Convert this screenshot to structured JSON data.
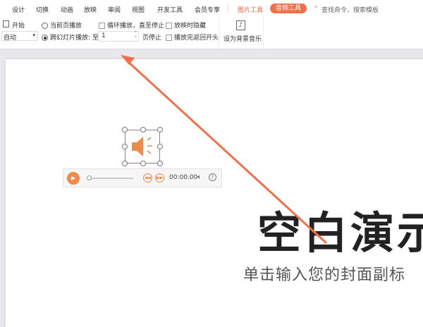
{
  "menu": {
    "tabs": [
      "设计",
      "切换",
      "动画",
      "放映",
      "审阅",
      "视图",
      "开发工具",
      "会员专享"
    ],
    "picture_tools": "图片工具",
    "audio_tools": "音频工具",
    "search_placeholder": "查找命令、搜索模板"
  },
  "ribbon": {
    "start_label": "开始",
    "start_value": "自动",
    "current_page": "当前页播放",
    "cross_slide": "跨幻灯片播放: 至",
    "page_value": "1",
    "page_stop": "页停止",
    "loop": "循环播放，直至停止",
    "hide": "放映时隐藏",
    "rewind": "播放完返回开头",
    "bg_music": "设为背景音乐"
  },
  "player": {
    "time": "00:00.00",
    "progress": 0
  },
  "slide": {
    "title": "空白演示",
    "subtitle": "单击输入您的封面副标"
  },
  "colors": {
    "accent": "#f0704a",
    "icon": "#ef8a4a"
  }
}
